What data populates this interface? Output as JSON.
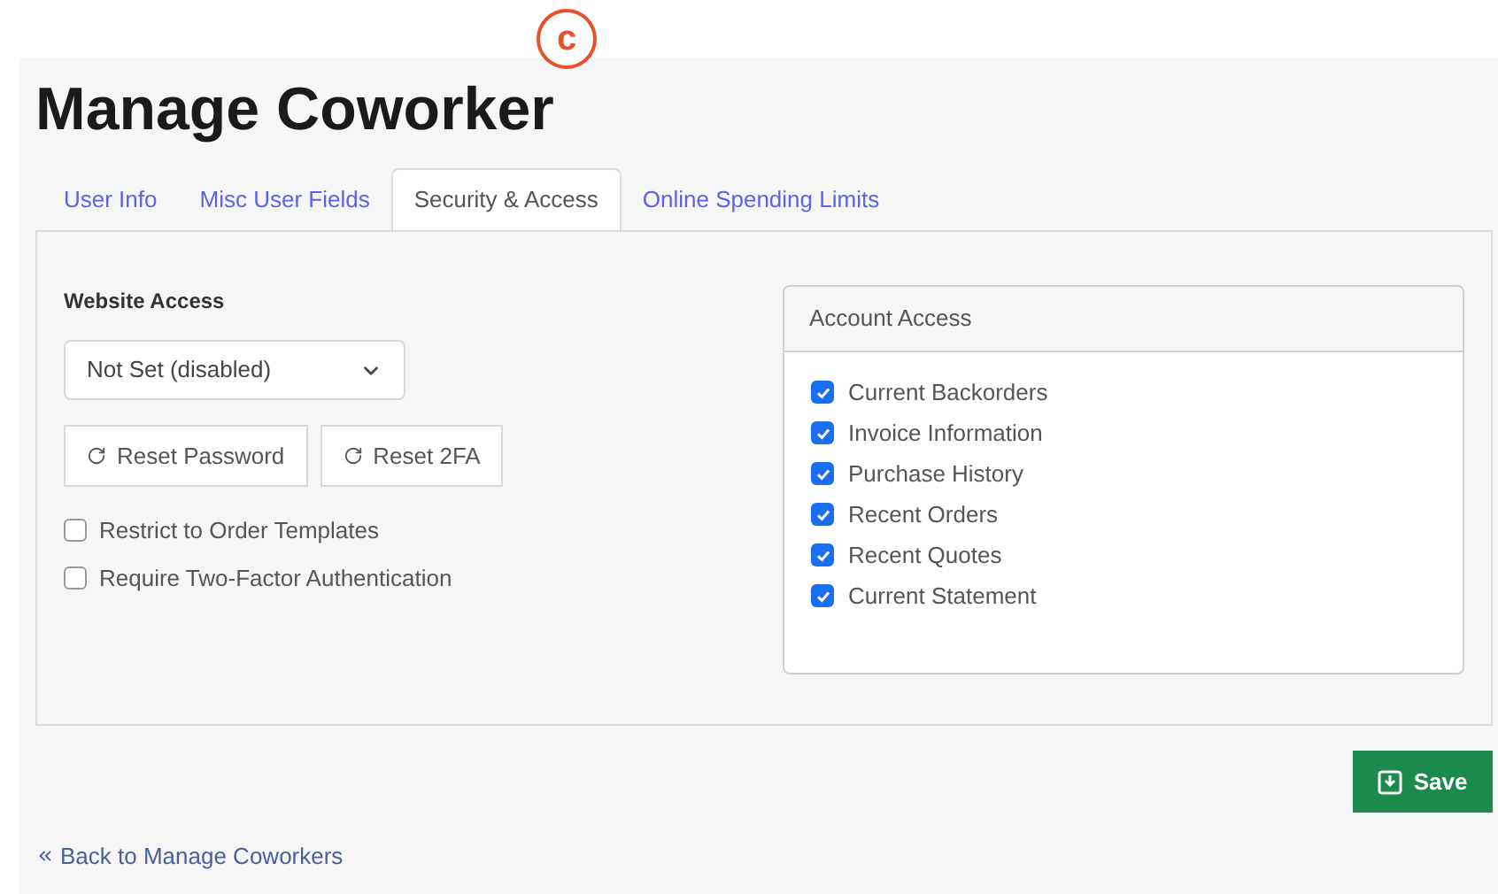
{
  "marker": "c",
  "title": "Manage Coworker",
  "tabs": [
    {
      "label": "User Info",
      "selected": false
    },
    {
      "label": "Misc User Fields",
      "selected": false
    },
    {
      "label": "Security & Access",
      "selected": true
    },
    {
      "label": "Online Spending Limits",
      "selected": false
    }
  ],
  "website_access": {
    "label": "Website Access",
    "value": "Not Set (disabled)"
  },
  "reset_buttons": [
    "Reset Password",
    "Reset 2FA"
  ],
  "options": [
    {
      "label": "Restrict to Order Templates",
      "checked": false
    },
    {
      "label": "Require Two-Factor Authentication",
      "checked": false
    }
  ],
  "account_access": {
    "title": "Account Access",
    "items": [
      {
        "label": "Current Backorders",
        "checked": true
      },
      {
        "label": "Invoice Information",
        "checked": true
      },
      {
        "label": "Purchase History",
        "checked": true
      },
      {
        "label": "Recent Orders",
        "checked": true
      },
      {
        "label": "Recent Quotes",
        "checked": true
      },
      {
        "label": "Current Statement",
        "checked": true
      }
    ]
  },
  "save_button": "Save",
  "back_link": "Back to Manage Coworkers"
}
